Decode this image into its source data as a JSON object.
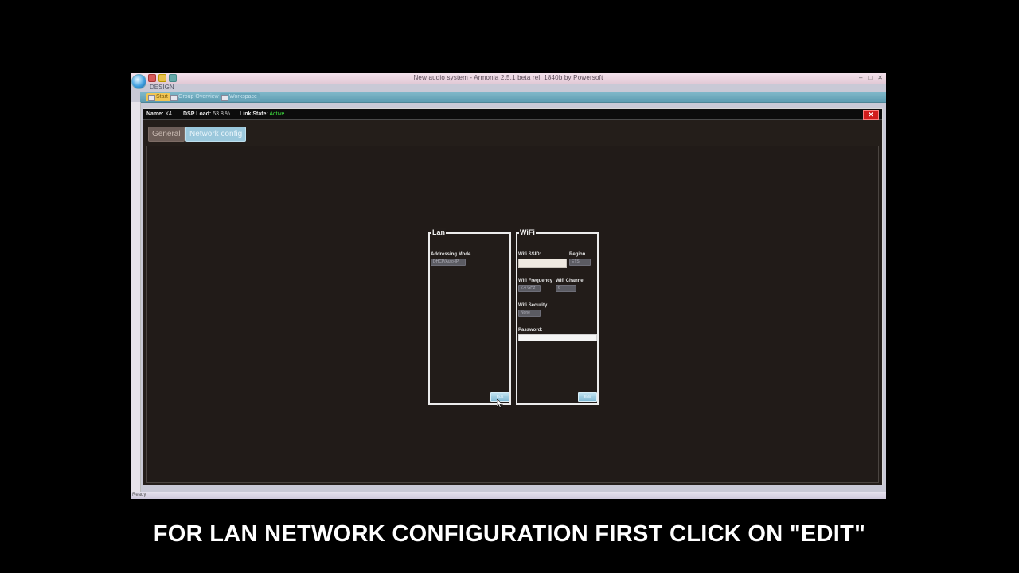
{
  "window": {
    "title": "New audio system - Armonia 2.5.1 beta rel. 1840b by Powersoft",
    "controls": [
      "–",
      "□",
      "✕"
    ],
    "ribbon_label": "DESIGN"
  },
  "tabs": [
    {
      "label": "Start"
    },
    {
      "label": "Group Overview"
    },
    {
      "label": "Workspace"
    }
  ],
  "status_bar": {
    "text": "Ready"
  },
  "device_panel": {
    "name_label": "Name:",
    "name_value": "X4",
    "dsp_label": "DSP Load:",
    "dsp_value": "53.8 %",
    "link_label": "Link State:",
    "link_value": "Active",
    "close_glyph": "✕",
    "tab_general": "General",
    "tab_network": "Network config"
  },
  "lan": {
    "title": "Lan",
    "addressing_mode_label": "Addressing Mode",
    "addressing_mode_value": "DHCP/Auto-IP",
    "edit_label": "Edit"
  },
  "wifi": {
    "title": "WiFi",
    "ssid_label": "Wifi SSID:",
    "ssid_value": "",
    "region_label": "Region",
    "region_value": "ETSI",
    "frequency_label": "Wifi Frequency",
    "frequency_value": "2.4 GHz",
    "channel_label": "Wifi Channel",
    "channel_value": "6",
    "security_label": "Wifi Security",
    "security_value": "None",
    "password_label": "Password:",
    "edit_label": "Edit"
  },
  "caption": "FOR LAN NETWORK CONFIGURATION FIRST CLICK ON \"EDIT\""
}
